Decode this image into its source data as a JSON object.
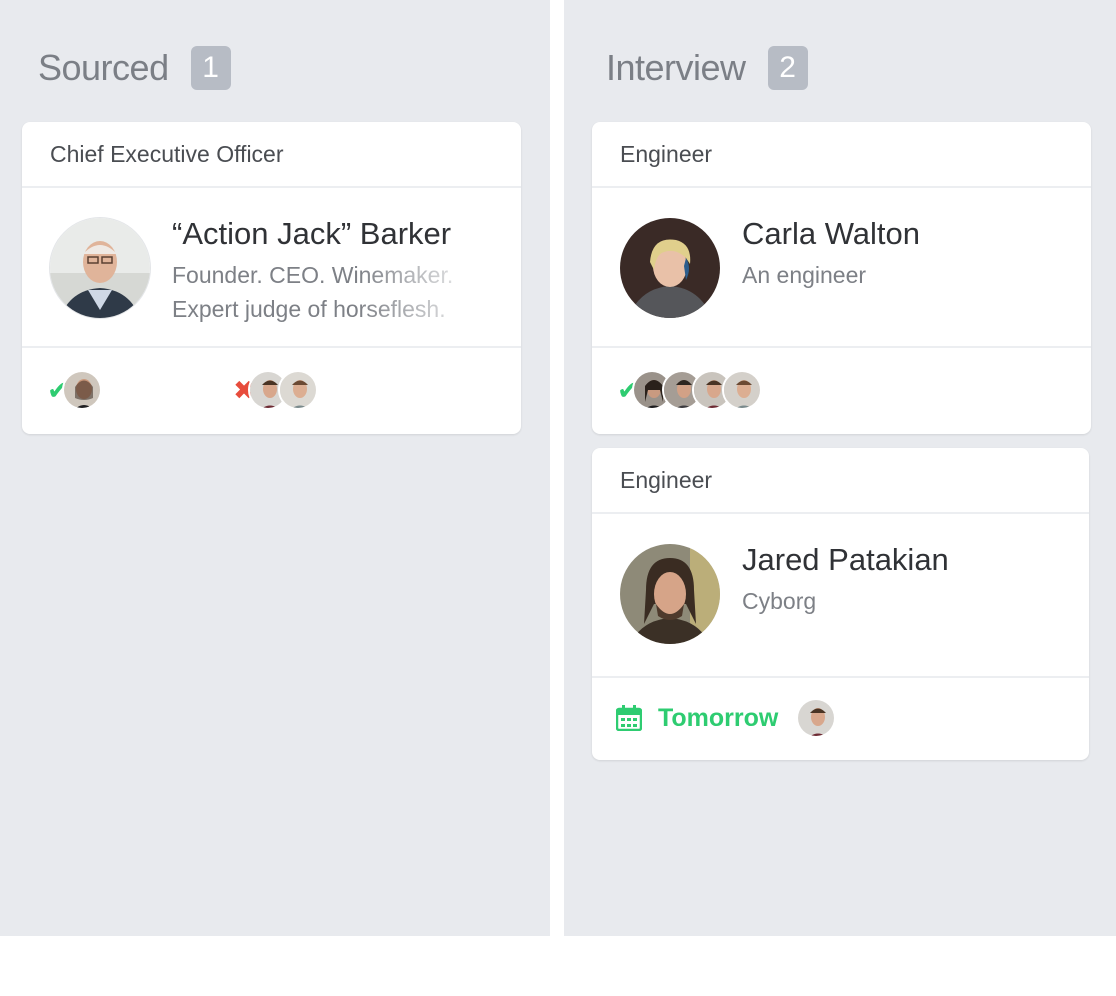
{
  "columns": [
    {
      "title": "Sourced",
      "count": "1",
      "cards": [
        {
          "role": "Chief Executive Officer",
          "name": "“Action Jack” Barker",
          "description": "Founder. CEO. Winemaker.\nExpert judge of horseflesh."
        }
      ]
    },
    {
      "title": "Interview",
      "count": "2",
      "cards": [
        {
          "role": "Engineer",
          "name": "Carla Walton",
          "description": "An engineer"
        },
        {
          "role": "Engineer",
          "name": "Jared Patakian",
          "description": "Cyborg",
          "schedule": "Tomorrow"
        }
      ]
    }
  ],
  "icons": {
    "approve": "check-icon",
    "reject": "x-icon",
    "schedule": "calendar-icon"
  },
  "colors": {
    "approve": "#2ecc71",
    "reject": "#e74c3c",
    "column_bg": "#e8eaee",
    "count_badge": "#b7bcc5"
  }
}
